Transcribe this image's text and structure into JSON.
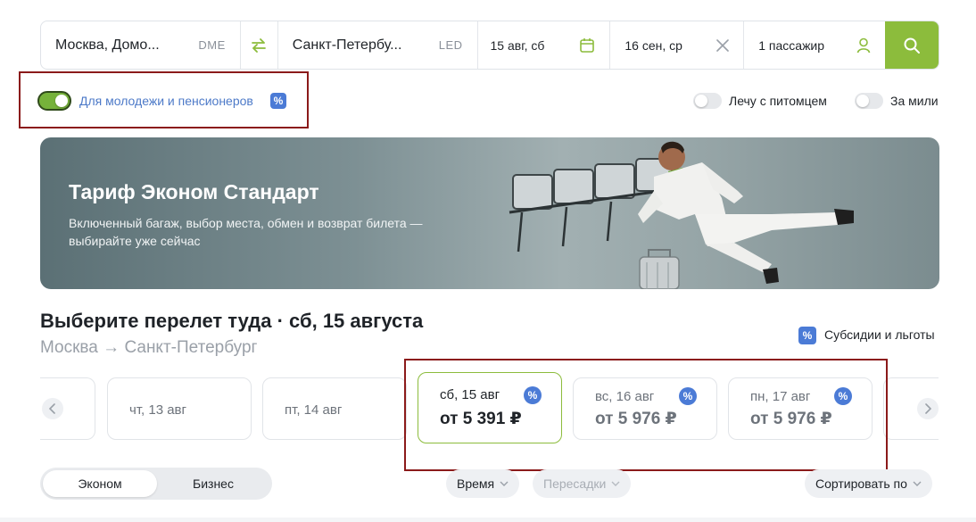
{
  "search": {
    "from_city": "Москва, Домо...",
    "from_code": "DME",
    "to_city": "Санкт-Петербу...",
    "to_code": "LED",
    "depart_date": "15 авг, сб",
    "return_date": "16 сен, ср",
    "passengers": "1 пассажир",
    "icons": {
      "swap": "swap-icon",
      "calendar": "calendar-icon",
      "clear": "close-icon",
      "passenger": "person-icon",
      "search": "search-icon"
    }
  },
  "options": {
    "youth_label": "Для молодежи и пенсионеров",
    "youth_on": true,
    "pet_label": "Лечу с питомцем",
    "pet_on": false,
    "miles_label": "За мили",
    "miles_on": false,
    "percent_symbol": "%"
  },
  "banner": {
    "title": "Тариф Эконом Стандарт",
    "description": "Включенный багаж, выбор места, обмен и возврат билета — выбирайте уже сейчас"
  },
  "flight": {
    "heading": "Выберите перелет туда · сб, 15 августа",
    "route_from": "Москва",
    "route_arrow": "→",
    "route_to": "Санкт-Петербург",
    "subsidy_label": "Субсидии и льготы"
  },
  "dates": [
    {
      "label": "чт, 13 авг",
      "price": ""
    },
    {
      "label": "пт, 14 авг",
      "price": ""
    },
    {
      "label": "сб, 15 авг",
      "price": "от 5 391 ₽",
      "selected": true,
      "discount": true
    },
    {
      "label": "вс, 16 авг",
      "price": "от 5 976 ₽",
      "discount": true
    },
    {
      "label": "пн, 17 авг",
      "price": "от 5 976 ₽",
      "discount": true
    }
  ],
  "controls": {
    "class_economy": "Эконом",
    "class_business": "Бизнес",
    "filter_time": "Время",
    "filter_transfers": "Пересадки",
    "sort_label": "Сортировать по"
  },
  "colors": {
    "accent_green": "#8cbc3c",
    "badge_blue": "#4b7bd6",
    "highlight_red": "#8b1a1a",
    "link_blue": "#4d7ac8"
  }
}
